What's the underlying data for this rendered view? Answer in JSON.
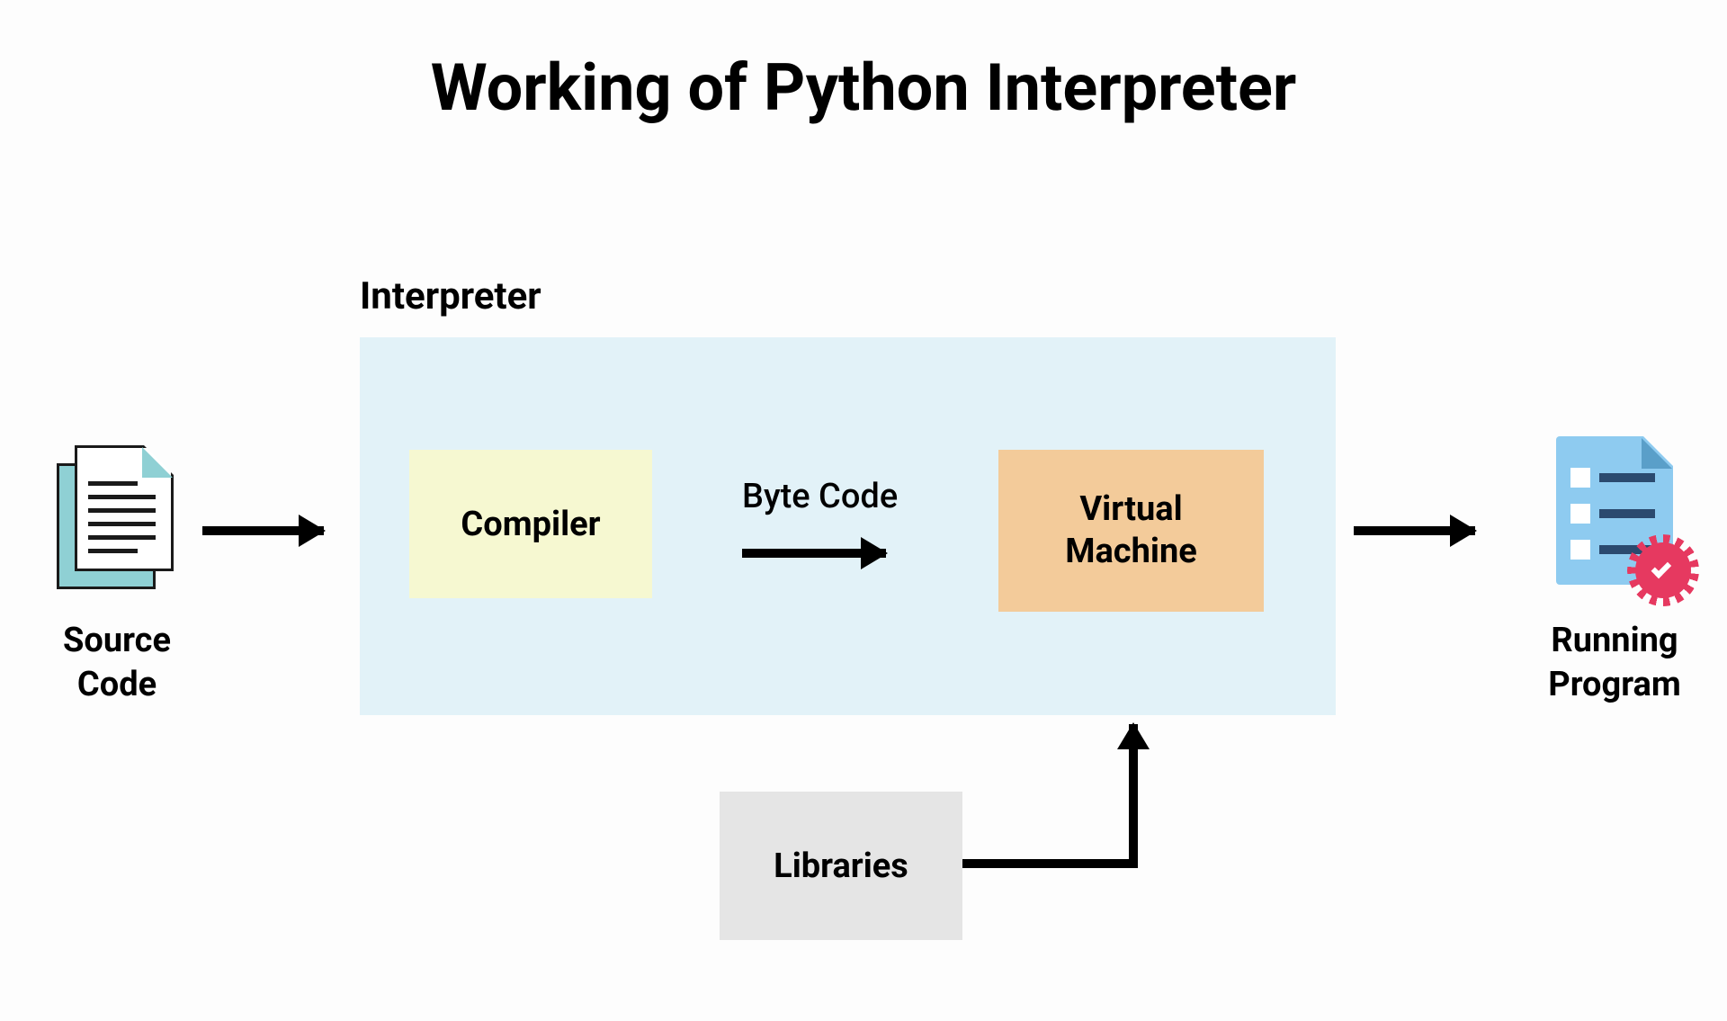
{
  "title": "Working of Python Interpreter",
  "interpreter_label": "Interpreter",
  "blocks": {
    "source": "Source\nCode",
    "compiler": "Compiler",
    "bytecode": "Byte Code",
    "vm": "Virtual\nMachine",
    "libraries": "Libraries",
    "running": "Running\nProgram"
  },
  "colors": {
    "interpreter_bg": "#e2f2f8",
    "compiler_bg": "#f6f8d1",
    "vm_bg": "#f3cb9a",
    "libraries_bg": "#e5e5e5",
    "badge": "#e63960"
  }
}
